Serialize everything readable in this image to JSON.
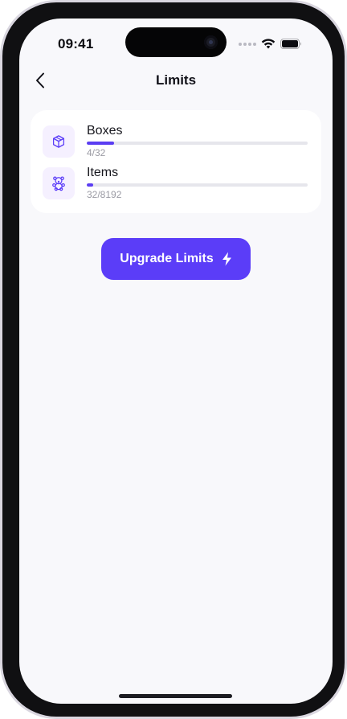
{
  "status_bar": {
    "time": "09:41",
    "icons": [
      "signal-dots-icon",
      "wifi-icon",
      "battery-icon"
    ]
  },
  "nav": {
    "back_icon": "chevron-left-icon",
    "title": "Limits"
  },
  "limits": [
    {
      "label": "Boxes",
      "count": "4/32",
      "used": 4,
      "total": 32,
      "icon": "box-icon"
    },
    {
      "label": "Items",
      "count": "32/8192",
      "used": 32,
      "total": 8192,
      "icon": "teddy-bear-icon"
    }
  ],
  "upgrade_button": {
    "label": "Upgrade Limits",
    "icon": "lightning-icon"
  },
  "colors": {
    "accent": "#5b3df8",
    "icon_bg": "#f5f0ff",
    "track": "#e6e6ec",
    "screen_bg": "#f8f8fb"
  }
}
